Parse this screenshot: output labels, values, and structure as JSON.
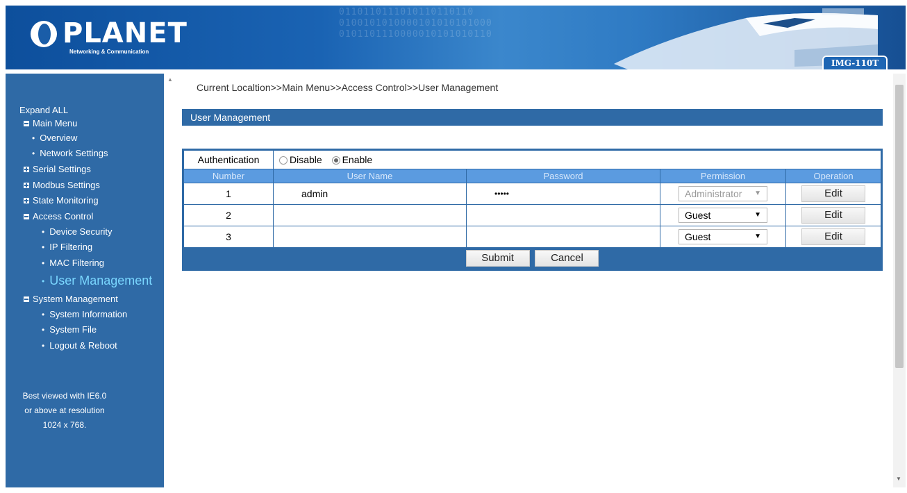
{
  "header": {
    "logo_name": "PLANET",
    "logo_tagline": "Networking & Communication",
    "model": "IMG-110T",
    "binary_art": "0110110111010110110110\n0100101010000101010101000\n0101101110000010101010110"
  },
  "sidebar": {
    "expand_all": "Expand ALL",
    "items": [
      {
        "label": "Main Menu",
        "type": "folder-open"
      },
      {
        "label": "Overview",
        "type": "link"
      },
      {
        "label": "Network Settings",
        "type": "link"
      },
      {
        "label": "Serial Settings",
        "type": "folder-closed"
      },
      {
        "label": "Modbus Settings",
        "type": "folder-closed"
      },
      {
        "label": "State Monitoring",
        "type": "folder-closed"
      },
      {
        "label": "Access Control",
        "type": "folder-open"
      },
      {
        "label": "Device Security",
        "type": "link"
      },
      {
        "label": "IP Filtering",
        "type": "link"
      },
      {
        "label": "MAC Filtering",
        "type": "link"
      },
      {
        "label": "User Management",
        "type": "link-active"
      },
      {
        "label": "System Management",
        "type": "folder-open"
      },
      {
        "label": "System Information",
        "type": "link"
      },
      {
        "label": "System File",
        "type": "link"
      },
      {
        "label": "Logout & Reboot",
        "type": "link"
      }
    ],
    "best_viewed": [
      "Best viewed with IE6.0",
      "or above at resolution",
      "1024 x 768."
    ]
  },
  "main": {
    "breadcrumb": "Current Localtion>>Main Menu>>Access Control>>User Management",
    "section_title": "User Management",
    "auth_label": "Authentication",
    "auth_options": [
      "Disable",
      "Enable"
    ],
    "auth_selected": "Enable",
    "columns": [
      "Number",
      "User Name",
      "Password",
      "Permission",
      "Operation"
    ],
    "rows": [
      {
        "number": "1",
        "username": "admin",
        "password": "•••••",
        "permission": "Administrator",
        "permission_disabled": true,
        "operation": "Edit"
      },
      {
        "number": "2",
        "username": "",
        "password": "",
        "permission": "Guest",
        "permission_disabled": false,
        "operation": "Edit"
      },
      {
        "number": "3",
        "username": "",
        "password": "",
        "permission": "Guest",
        "permission_disabled": false,
        "operation": "Edit"
      }
    ],
    "submit_label": "Submit",
    "cancel_label": "Cancel"
  },
  "colors": {
    "sidebar_bg": "#2f6aa6",
    "header_bg": "#1a63b3",
    "table_header_bg": "#5b9be0",
    "active_link": "#7ad7ff"
  }
}
